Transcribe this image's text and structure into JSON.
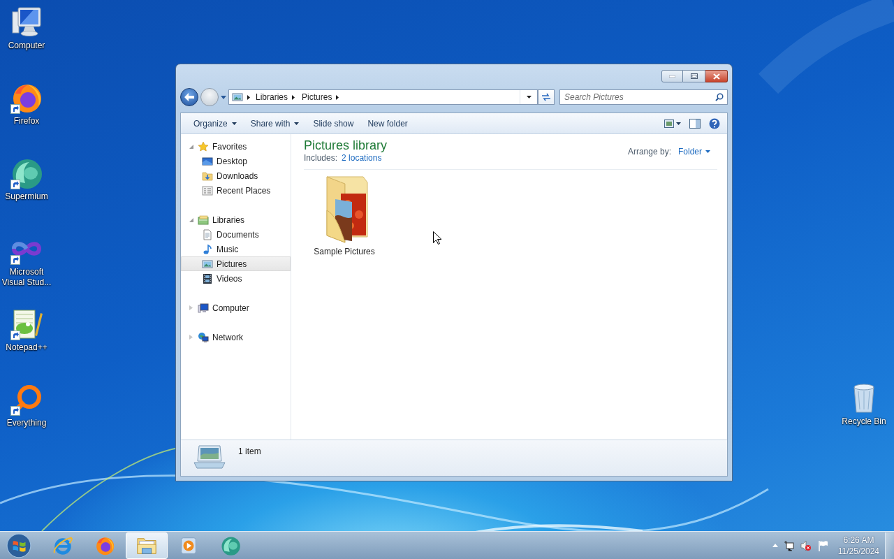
{
  "desktop_icons": [
    {
      "label": "Computer",
      "kind": "computer",
      "shortcut": false
    },
    {
      "label": "Firefox",
      "kind": "firefox",
      "shortcut": true
    },
    {
      "label": "Supermium",
      "kind": "supermium",
      "shortcut": true
    },
    {
      "label": "Microsoft Visual Stud...",
      "kind": "vs",
      "shortcut": true
    },
    {
      "label": "Notepad++",
      "kind": "notepad",
      "shortcut": true
    },
    {
      "label": "Everything",
      "kind": "everything",
      "shortcut": true
    }
  ],
  "recycle_bin": {
    "label": "Recycle Bin"
  },
  "window": {
    "breadcrumb": [
      "Libraries",
      "Pictures"
    ],
    "search": {
      "placeholder": "Search Pictures"
    },
    "toolbar": [
      {
        "label": "Organize",
        "dropdown": true
      },
      {
        "label": "Share with",
        "dropdown": true
      },
      {
        "label": "Slide show",
        "dropdown": false
      },
      {
        "label": "New folder",
        "dropdown": false
      }
    ],
    "nav": [
      {
        "label": "Favorites",
        "kind": "star",
        "expanded": true,
        "selected": false,
        "children": [
          {
            "label": "Desktop",
            "kind": "desktop",
            "selected": false
          },
          {
            "label": "Downloads",
            "kind": "downloads",
            "selected": false
          },
          {
            "label": "Recent Places",
            "kind": "recent",
            "selected": false
          }
        ]
      },
      {
        "label": "Libraries",
        "kind": "library",
        "expanded": true,
        "selected": false,
        "children": [
          {
            "label": "Documents",
            "kind": "document",
            "selected": false
          },
          {
            "label": "Music",
            "kind": "music",
            "selected": false
          },
          {
            "label": "Pictures",
            "kind": "pictures",
            "selected": true
          },
          {
            "label": "Videos",
            "kind": "videos",
            "selected": false
          }
        ]
      },
      {
        "label": "Computer",
        "kind": "computer",
        "expanded": false,
        "selected": false
      },
      {
        "label": "Network",
        "kind": "network",
        "expanded": false,
        "selected": false
      }
    ],
    "library": {
      "title": "Pictures library",
      "includes_label": "Includes:",
      "includes_link": "2 locations",
      "arrange_label": "Arrange by:",
      "arrange_value": "Folder"
    },
    "items": [
      {
        "label": "Sample Pictures",
        "kind": "picture-folder"
      }
    ],
    "status": "1 item"
  },
  "taskbar": {
    "buttons": [
      {
        "kind": "start",
        "selected": false
      },
      {
        "kind": "ie",
        "selected": false
      },
      {
        "kind": "firefox",
        "selected": false
      },
      {
        "kind": "explorer",
        "selected": true
      },
      {
        "kind": "media",
        "selected": false
      },
      {
        "kind": "supermium",
        "selected": false
      }
    ],
    "time": "6:26 AM",
    "date": "11/25/2024"
  }
}
